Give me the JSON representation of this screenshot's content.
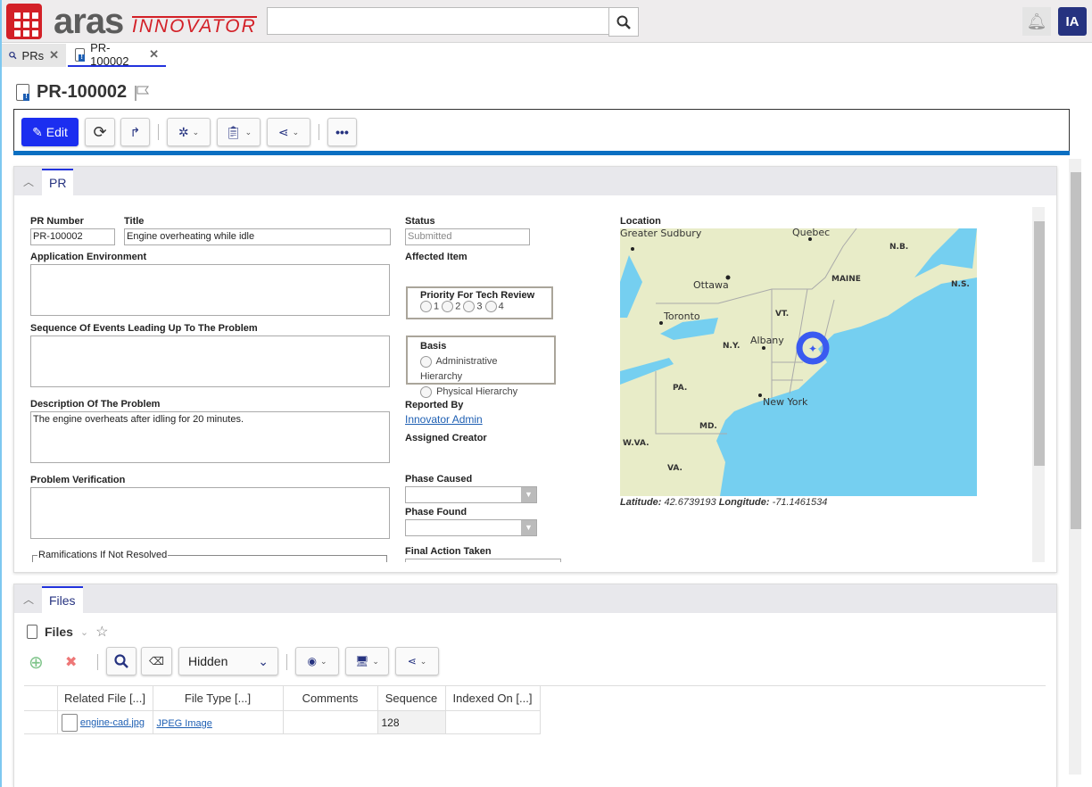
{
  "header": {
    "logo_main": "aras",
    "logo_sub": "INNOVATOR",
    "search_placeholder": "",
    "avatar_initials": "IA"
  },
  "tabs": [
    {
      "label": "PRs",
      "icon": "search-icon"
    },
    {
      "label": "PR-100002",
      "icon": "pr-document-icon",
      "active": true
    }
  ],
  "item": {
    "title": "PR-100002"
  },
  "toolbar": {
    "edit_label": "Edit",
    "accent": "#1b2ef0"
  },
  "pr_panel": {
    "tab": "PR",
    "fields": {
      "pr_number": {
        "label": "PR Number",
        "value": "PR-100002"
      },
      "title": {
        "label": "Title",
        "value": "Engine overheating while idle"
      },
      "status": {
        "label": "Status",
        "value": "Submitted"
      },
      "application_environment": {
        "label": "Application Environment",
        "value": ""
      },
      "affected_item": {
        "label": "Affected Item",
        "value": ""
      },
      "sequence_of_events": {
        "label": "Sequence Of Events Leading Up To The Problem",
        "value": ""
      },
      "description": {
        "label": "Description Of The Problem",
        "value": "The engine overheats after idling for 20 minutes."
      },
      "problem_verification": {
        "label": "Problem Verification",
        "value": ""
      },
      "ramifications": {
        "label": "Ramifications If Not Resolved"
      },
      "priority": {
        "label": "Priority For Tech Review",
        "options": [
          "1",
          "2",
          "3",
          "4"
        ]
      },
      "basis": {
        "label": "Basis",
        "options": [
          "Administrative Hierarchy",
          "Physical Hierarchy"
        ]
      },
      "reported_by": {
        "label": "Reported By",
        "value": "Innovator Admin"
      },
      "assigned_creator": {
        "label": "Assigned Creator",
        "value": ""
      },
      "phase_caused": {
        "label": "Phase Caused",
        "value": ""
      },
      "phase_found": {
        "label": "Phase Found",
        "value": ""
      },
      "final_action_taken": {
        "label": "Final Action Taken",
        "value": ""
      }
    },
    "location": {
      "label": "Location",
      "latitude_label": "Latitude:",
      "latitude": "42.6739193",
      "longitude_label": "Longitude:",
      "longitude": "-71.1461534",
      "map_labels": {
        "sudbury": "Greater Sudbury",
        "quebec": "Quebec",
        "nb": "N.B.",
        "ottawa": "Ottawa",
        "maine": "MAINE",
        "ns": "N.S.",
        "toronto": "Toronto",
        "vt": "VT.",
        "ny": "N.Y.",
        "albany": "Albany",
        "pa": "PA.",
        "newyork": "New York",
        "md": "MD.",
        "wva": "W.VA.",
        "va": "VA."
      },
      "colors": {
        "land": "#e8ecc8",
        "water": "#75cff0",
        "marker": "#3a5af0"
      }
    }
  },
  "files_panel": {
    "tab": "Files",
    "title": "Files",
    "filter_select": "Hidden",
    "columns": [
      "",
      "Related File [...]",
      "File Type [...]",
      "Comments",
      "Sequence",
      "Indexed On [...]"
    ],
    "rows": [
      {
        "related_file": "engine-cad.jpg",
        "file_type": "JPEG Image",
        "comments": "",
        "sequence": "128",
        "indexed_on": ""
      }
    ]
  }
}
